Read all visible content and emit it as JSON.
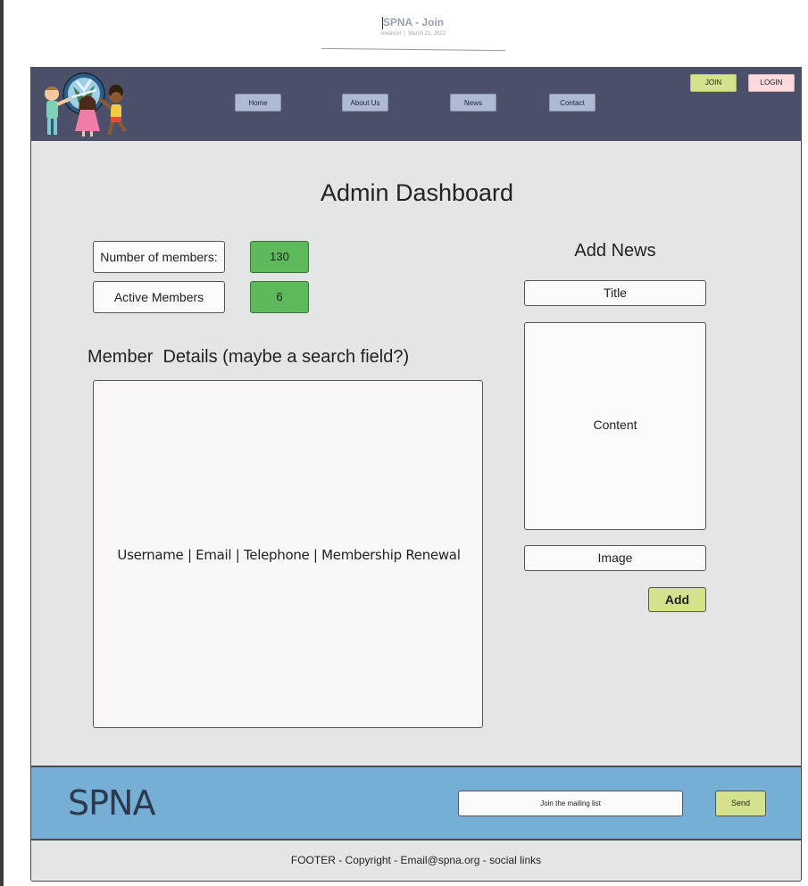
{
  "doc": {
    "title": "SPNA - Join",
    "author": "ewancel",
    "date": "March 21, 2022"
  },
  "header": {
    "logo_icon": "children-globe-logo-icon",
    "nav": [
      "Home",
      "About Us",
      "News",
      "Contact"
    ],
    "join_label": "JOIN",
    "login_label": "LOGIN"
  },
  "main": {
    "title": "Admin Dashboard",
    "stats": {
      "members_label": "Number of members:",
      "members_value": "130",
      "active_label": "Active Members",
      "active_value": "6"
    },
    "member_details": {
      "heading": "Member  Details (maybe a search field?)",
      "columns": "Username | Email | Telephone | Membership Renewal"
    },
    "add_news": {
      "heading": "Add News",
      "title_label": "Title",
      "content_label": "Content",
      "image_label": "Image",
      "add_label": "Add"
    }
  },
  "footer": {
    "brand": "SPNA",
    "mailing_placeholder": "Join the mailing list",
    "send_label": "Send",
    "copyright": "FOOTER - Copyright - Email@spna.org - social links"
  },
  "colors": {
    "header_bg": "#4b5068",
    "nav_button": "#aebad4",
    "join_button": "#d5e28c",
    "login_button": "#fcd9dc",
    "stat_value_bg": "#5cba5c",
    "footer_blue": "#76aed6",
    "panel_bg": "#e4e6e6"
  }
}
